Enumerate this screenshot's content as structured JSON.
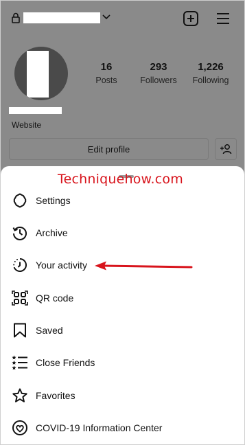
{
  "profile": {
    "stats": [
      {
        "value": "16",
        "label": "Posts"
      },
      {
        "value": "293",
        "label": "Followers"
      },
      {
        "value": "1,226",
        "label": "Following"
      }
    ],
    "website_label": "Website",
    "edit_profile_label": "Edit profile"
  },
  "sheet": {
    "watermark": "Techniquehow.com",
    "items": [
      {
        "label": "Settings",
        "icon": "settings-icon"
      },
      {
        "label": "Archive",
        "icon": "archive-icon"
      },
      {
        "label": "Your activity",
        "icon": "activity-icon"
      },
      {
        "label": "QR code",
        "icon": "qr-code-icon"
      },
      {
        "label": "Saved",
        "icon": "bookmark-icon"
      },
      {
        "label": "Close Friends",
        "icon": "close-friends-icon"
      },
      {
        "label": "Favorites",
        "icon": "star-icon"
      },
      {
        "label": "COVID-19 Information Center",
        "icon": "covid-info-icon"
      }
    ]
  },
  "colors": {
    "overlay_gray": "#8a8a8a",
    "annotation_red": "#d8141c"
  }
}
